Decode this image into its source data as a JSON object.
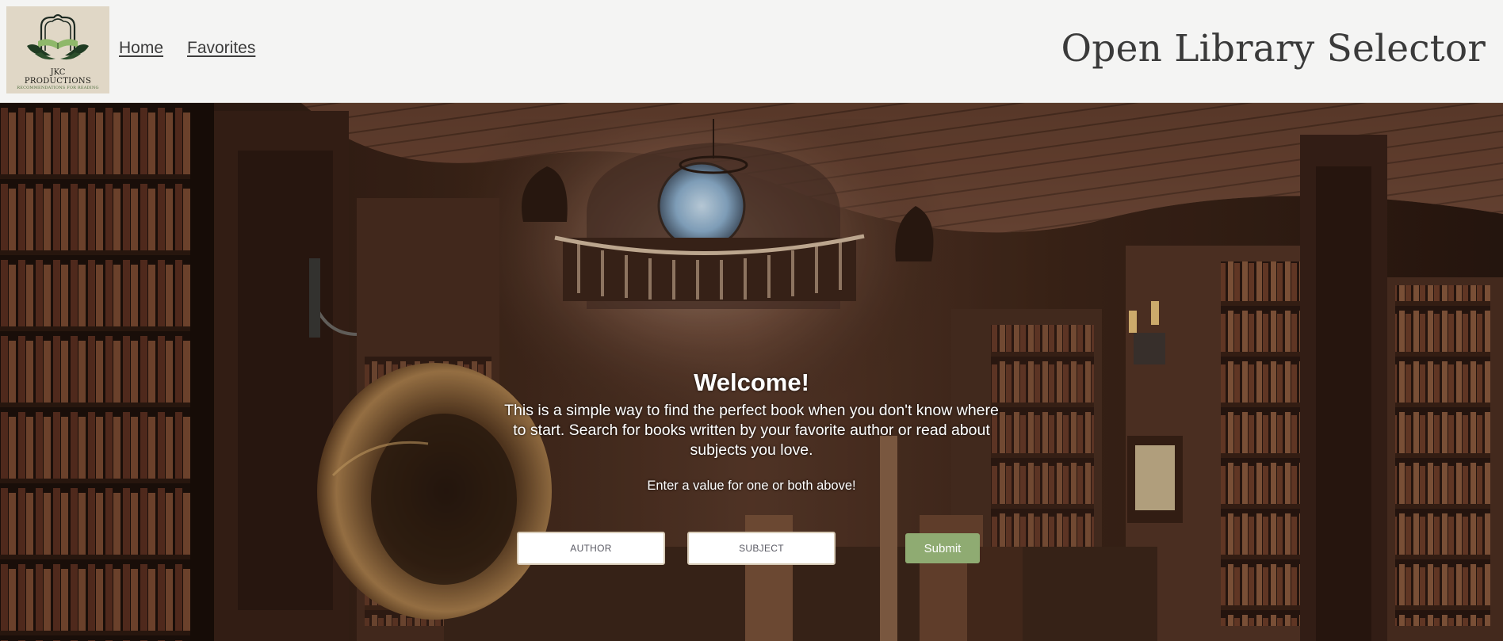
{
  "logo": {
    "line1": "JKC",
    "line2": "PRODUCTIONS",
    "line3": "RECOMMENDATIONS FOR READING"
  },
  "nav": {
    "home": "Home",
    "favorites": "Favorites"
  },
  "site_title": "Open Library Selector",
  "hero": {
    "heading": "Welcome!",
    "intro": "This is a simple way to find the perfect book when you don't know where to start. Search for books written by your favorite author or read about subjects you love.",
    "hint": "Enter a value for one or both above!"
  },
  "form": {
    "author_placeholder": "AUTHOR",
    "author_value": "",
    "subject_placeholder": "SUBJECT",
    "subject_value": "",
    "submit_label": "Submit"
  },
  "colors": {
    "header_bg": "#f4f4f3",
    "logo_bg": "#e0d7c6",
    "logo_green": "#4c6b3c",
    "submit_bg": "#8fab72",
    "title_text": "#3a3a3a"
  },
  "icons": {
    "logo": "open-book-hands-icon",
    "background": "library-interior-image"
  }
}
